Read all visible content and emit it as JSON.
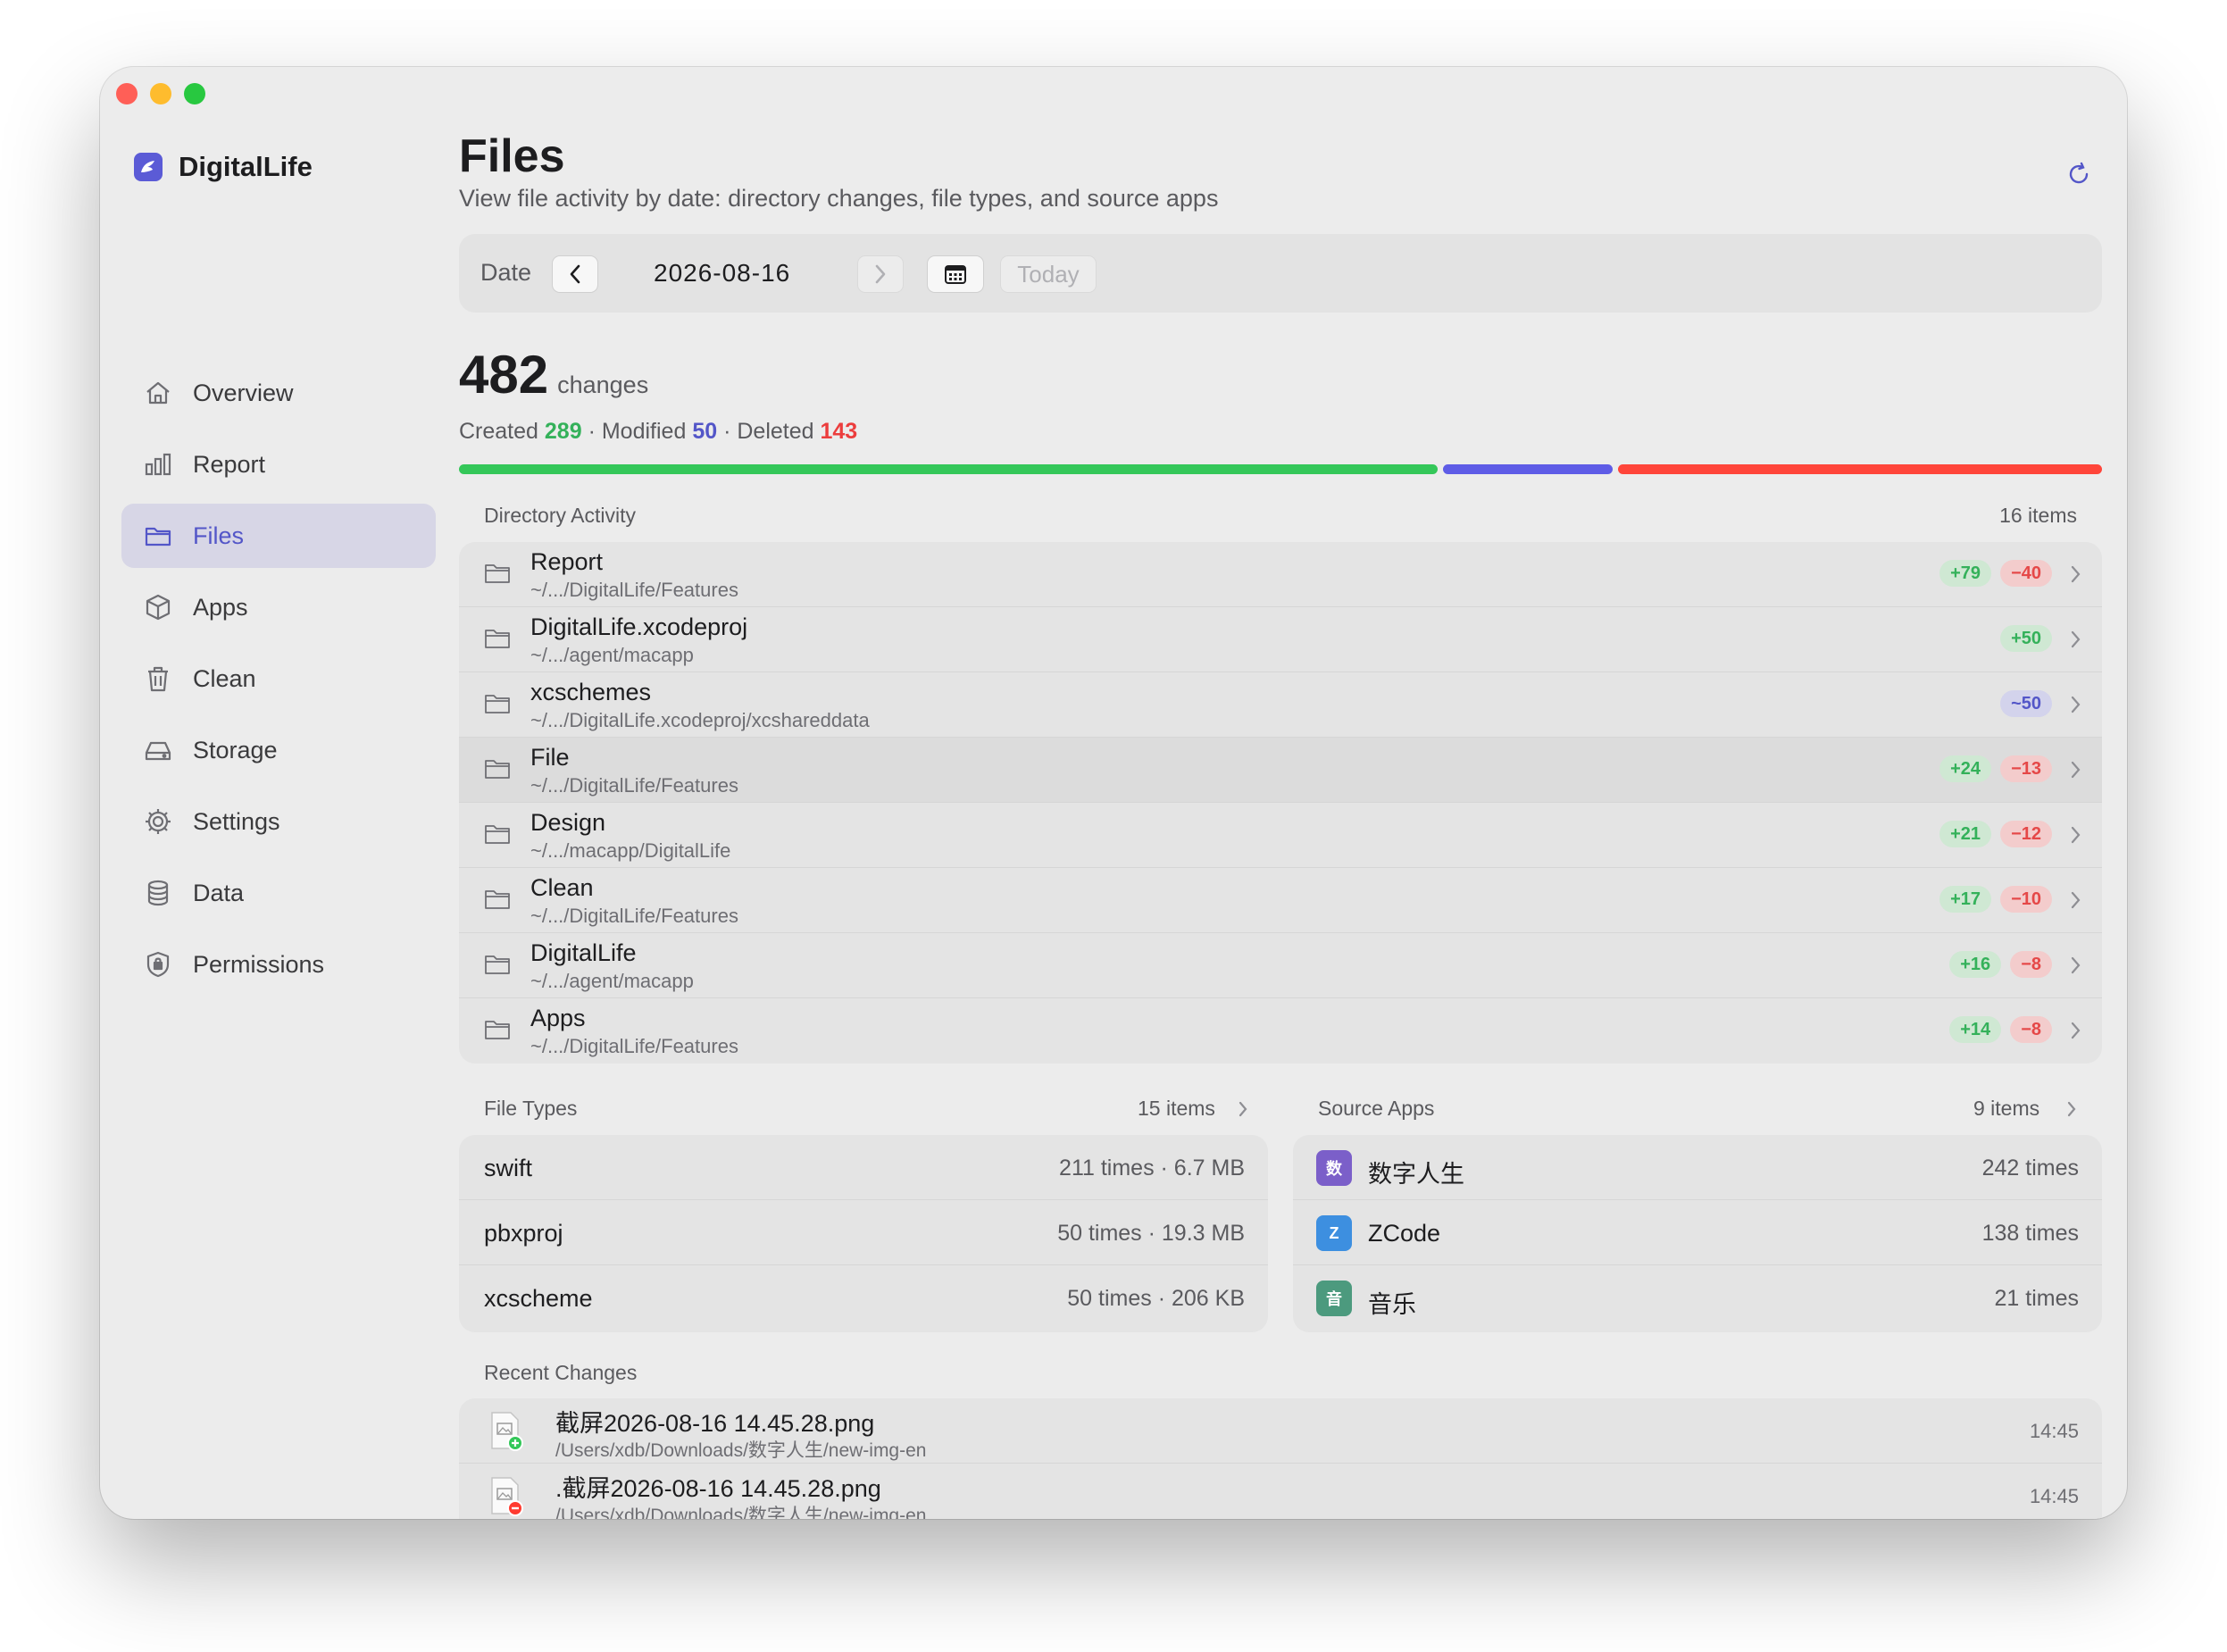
{
  "window": {
    "traffic_lights": {
      "close": "#ff5f57",
      "minimize": "#febc2e",
      "zoom": "#28c840"
    }
  },
  "app": {
    "name": "DigitalLife",
    "accent": "#5356c8"
  },
  "sidebar": {
    "items": [
      {
        "label": "Overview",
        "icon": "house-icon",
        "active": false
      },
      {
        "label": "Report",
        "icon": "bar-chart-icon",
        "active": false
      },
      {
        "label": "Files",
        "icon": "folder-icon",
        "active": true
      },
      {
        "label": "Apps",
        "icon": "cube-icon",
        "active": false
      },
      {
        "label": "Clean",
        "icon": "trash-icon",
        "active": false
      },
      {
        "label": "Storage",
        "icon": "drive-icon",
        "active": false
      },
      {
        "label": "Settings",
        "icon": "gear-icon",
        "active": false
      },
      {
        "label": "Data",
        "icon": "database-icon",
        "active": false
      },
      {
        "label": "Permissions",
        "icon": "shield-lock-icon",
        "active": false
      }
    ]
  },
  "header": {
    "title": "Files",
    "subtitle": "View file activity by date: directory changes, file types, and source apps"
  },
  "datebar": {
    "label": "Date",
    "value": "2026-08-16",
    "today_label": "Today"
  },
  "summary": {
    "total": "482",
    "unit": "changes",
    "created_label": "Created",
    "created": "289",
    "modified_label": "Modified",
    "modified": "50",
    "deleted_label": "Deleted",
    "deleted": "143",
    "separator": "·",
    "colors": {
      "created": "#34c759",
      "modified": "#5e5ce6",
      "deleted": "#ff453a"
    }
  },
  "directory_activity": {
    "label": "Directory Activity",
    "count": "16 items",
    "rows": [
      {
        "name": "Report",
        "path": "~/.../DigitalLife/Features",
        "added": "+79",
        "deleted": "−40",
        "modified": ""
      },
      {
        "name": "DigitalLife.xcodeproj",
        "path": "~/.../agent/macapp",
        "added": "+50",
        "deleted": "",
        "modified": ""
      },
      {
        "name": "xcschemes",
        "path": "~/.../DigitalLife.xcodeproj/xcshareddata",
        "added": "",
        "deleted": "",
        "modified": "~50"
      },
      {
        "name": "File",
        "path": "~/.../DigitalLife/Features",
        "added": "+24",
        "deleted": "−13",
        "modified": ""
      },
      {
        "name": "Design",
        "path": "~/.../macapp/DigitalLife",
        "added": "+21",
        "deleted": "−12",
        "modified": ""
      },
      {
        "name": "Clean",
        "path": "~/.../DigitalLife/Features",
        "added": "+17",
        "deleted": "−10",
        "modified": ""
      },
      {
        "name": "DigitalLife",
        "path": "~/.../agent/macapp",
        "added": "+16",
        "deleted": "−8",
        "modified": ""
      },
      {
        "name": "Apps",
        "path": "~/.../DigitalLife/Features",
        "added": "+14",
        "deleted": "−8",
        "modified": ""
      }
    ]
  },
  "file_types": {
    "label": "File Types",
    "count": "15 items",
    "rows": [
      {
        "name": "swift",
        "meta": "211 times · 6.7 MB"
      },
      {
        "name": "pbxproj",
        "meta": "50 times · 19.3 MB"
      },
      {
        "name": "xcscheme",
        "meta": "50 times · 206 KB"
      }
    ]
  },
  "source_apps": {
    "label": "Source Apps",
    "count": "9 items",
    "rows": [
      {
        "name": "数字人生",
        "icon_text": "数",
        "icon_color": "#7b5fc9",
        "meta": "242 times"
      },
      {
        "name": "ZCode",
        "icon_text": "Z",
        "icon_color": "#3d8fe0",
        "meta": "138 times"
      },
      {
        "name": "音乐",
        "icon_text": "音",
        "icon_color": "#4c9a7e",
        "meta": "21 times"
      }
    ]
  },
  "recent_changes": {
    "label": "Recent Changes",
    "rows": [
      {
        "name": "截屏2026-08-16 14.45.28.png",
        "path": "/Users/xdb/Downloads/数字人生/new-img-en",
        "time": "14:45",
        "kind": "created"
      },
      {
        "name": ".截屏2026-08-16 14.45.28.png",
        "path": "/Users/xdb/Downloads/数字人生/new-img-en",
        "time": "14:45",
        "kind": "deleted"
      }
    ]
  }
}
